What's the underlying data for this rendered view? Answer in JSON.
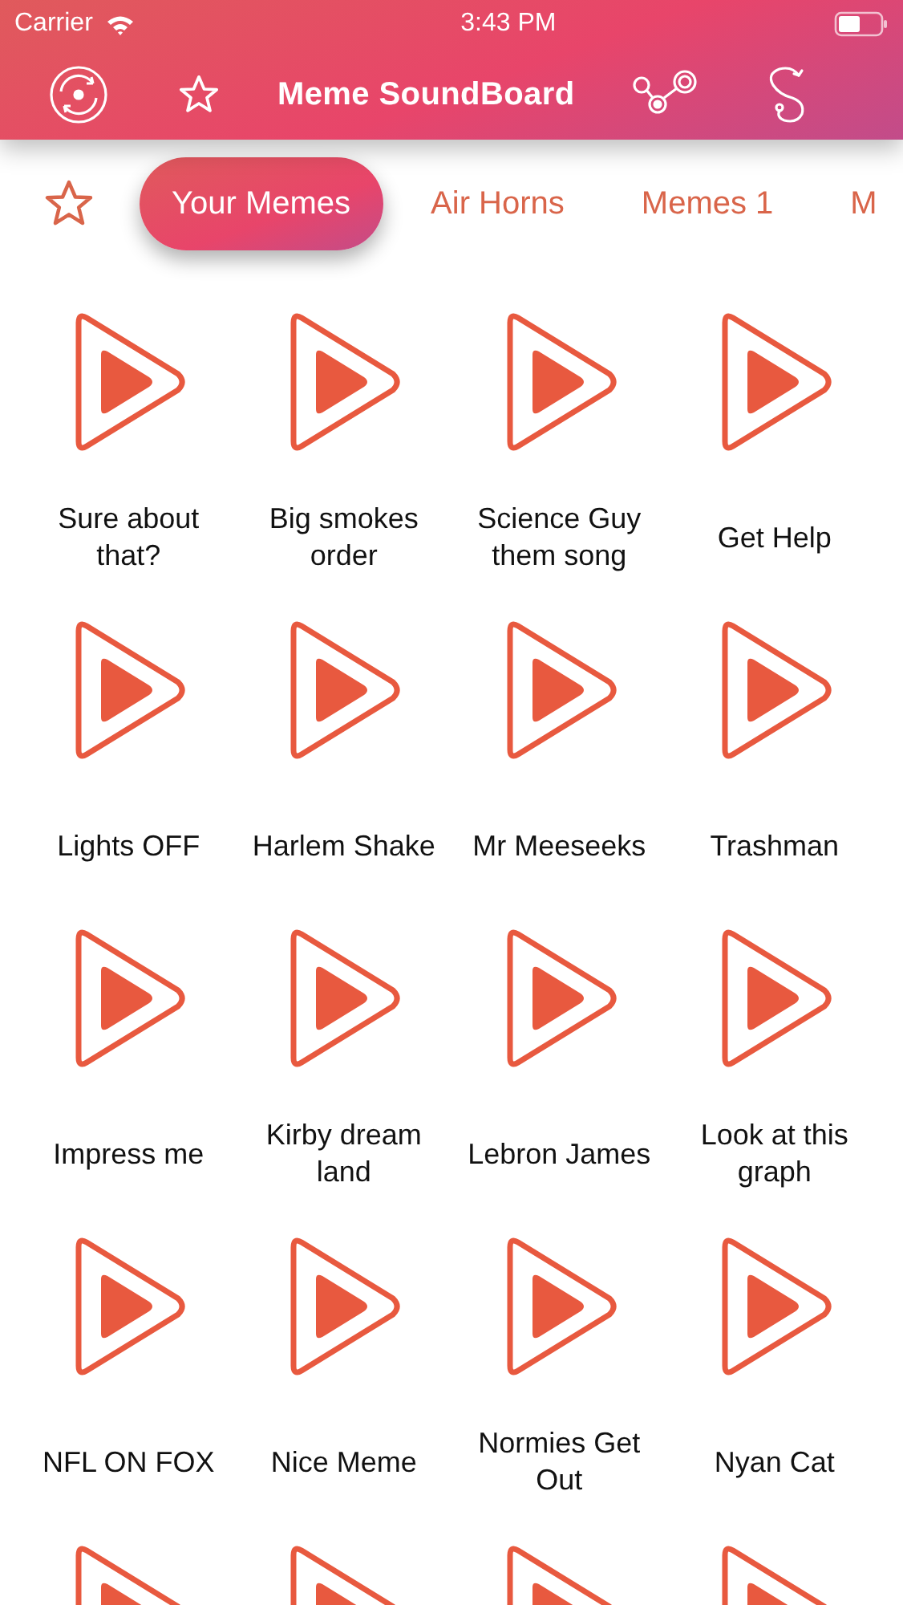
{
  "status_bar": {
    "carrier": "Carrier",
    "time": "3:43 PM"
  },
  "nav": {
    "title": "Meme SoundBoard"
  },
  "tabs": [
    {
      "label": "Your Memes",
      "selected": true
    },
    {
      "label": "Air Horns",
      "selected": false
    },
    {
      "label": "Memes 1",
      "selected": false
    },
    {
      "label": "M",
      "selected": false
    }
  ],
  "sounds": [
    {
      "kind": "sound",
      "label": "Sure about that?"
    },
    {
      "kind": "sound",
      "label": "Big smokes order"
    },
    {
      "kind": "sound",
      "label": "Science Guy them song"
    },
    {
      "kind": "sound",
      "label": "Get Help"
    },
    {
      "kind": "sound",
      "label": "Lights OFF"
    },
    {
      "kind": "sound",
      "label": "Harlem Shake"
    },
    {
      "kind": "sound",
      "label": "Mr Meeseeks"
    },
    {
      "kind": "sound",
      "label": "Trashman"
    },
    {
      "kind": "sound",
      "label": "Impress me"
    },
    {
      "kind": "sound",
      "label": "Kirby dream land"
    },
    {
      "kind": "sound",
      "label": "Lebron James"
    },
    {
      "kind": "sound",
      "label": "Look at this graph"
    },
    {
      "kind": "sound",
      "label": "NFL ON FOX"
    },
    {
      "kind": "sound",
      "label": "Nice Meme"
    },
    {
      "kind": "sound",
      "label": "Normies Get Out"
    },
    {
      "kind": "sound",
      "label": "Nyan Cat"
    },
    {
      "kind": "cut"
    },
    {
      "kind": "cut"
    },
    {
      "kind": "cut"
    },
    {
      "kind": "cut"
    }
  ]
}
